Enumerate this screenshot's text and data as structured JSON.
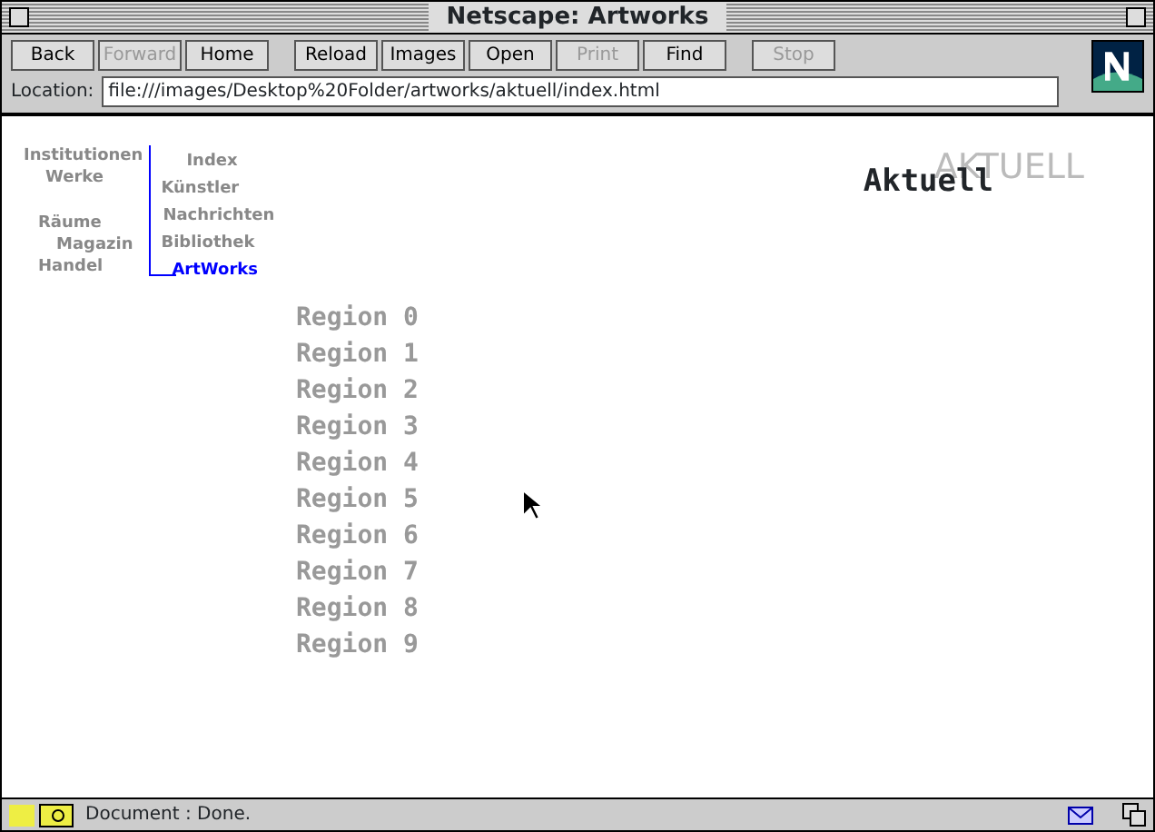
{
  "window": {
    "title": "Netscape: Artworks"
  },
  "toolbar": {
    "groups": [
      [
        {
          "label": "Back",
          "disabled": false
        },
        {
          "label": "Forward",
          "disabled": true
        },
        {
          "label": "Home",
          "disabled": false
        }
      ],
      [
        {
          "label": "Reload",
          "disabled": false
        },
        {
          "label": "Images",
          "disabled": false
        },
        {
          "label": "Open",
          "disabled": false
        },
        {
          "label": "Print",
          "disabled": true
        },
        {
          "label": "Find",
          "disabled": false
        }
      ],
      [
        {
          "label": "Stop",
          "disabled": true
        }
      ]
    ]
  },
  "location": {
    "label": "Location:",
    "value": "file:///images/Desktop%20Folder/artworks/aktuell/index.html"
  },
  "page": {
    "left_nav": [
      {
        "label": "Institutionen"
      },
      {
        "label": "Werke"
      },
      {
        "label": "Räume"
      },
      {
        "label": "Magazin"
      },
      {
        "label": "Handel"
      }
    ],
    "right_nav": [
      {
        "label": "Index",
        "selected": false
      },
      {
        "label": "Künstler",
        "selected": false
      },
      {
        "label": "Nachrichten",
        "selected": false
      },
      {
        "label": "Bibliothek",
        "selected": false
      },
      {
        "label": "ArtWorks",
        "selected": true
      }
    ],
    "heading": "Aktuell",
    "heading_shadow": "AKTUELL",
    "regions": [
      "Region 0",
      "Region 1",
      "Region 2",
      "Region 3",
      "Region 4",
      "Region 5",
      "Region 6",
      "Region 7",
      "Region 8",
      "Region 9"
    ]
  },
  "status_bar": {
    "text": "Document : Done."
  }
}
